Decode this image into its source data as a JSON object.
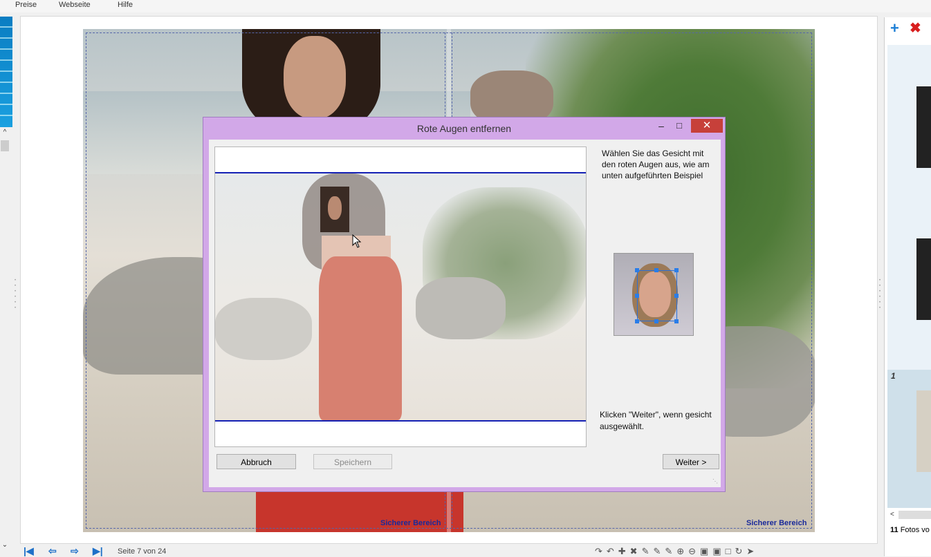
{
  "menu": {
    "items": [
      "Preise",
      "Webseite",
      "Hilfe"
    ]
  },
  "canvas": {
    "safe_area_label": "Sicherer Bereich"
  },
  "right_panel": {
    "photo_count_number": "11",
    "photo_count_text": "Fotos vo",
    "selected_index": "1"
  },
  "bottom_bar": {
    "page_info": "Seite 7 von 24"
  },
  "dialog": {
    "title": "Rote Augen entfernen",
    "instruction_top": "Wählen Sie das Gesicht mit den roten Augen aus, wie am unten aufgeführten Beispiel",
    "instruction_bottom": "Klicken \"Weiter\", wenn gesicht ausgewählt.",
    "buttons": {
      "cancel": "Abbruch",
      "save": "Speichern",
      "next": "Weiter >"
    }
  },
  "colors": {
    "dialog_frame": "#d2a8e8",
    "close_button": "#c7403a",
    "selection_line": "#1420b4",
    "safe_area_text": "#1a2a9a"
  },
  "icons": [
    "plus-icon",
    "delete-x-icon",
    "first-page-icon",
    "prev-page-icon",
    "next-page-icon",
    "last-page-icon",
    "minimize-icon",
    "maximize-icon",
    "close-icon",
    "resize-grip-icon",
    "cursor-icon"
  ]
}
